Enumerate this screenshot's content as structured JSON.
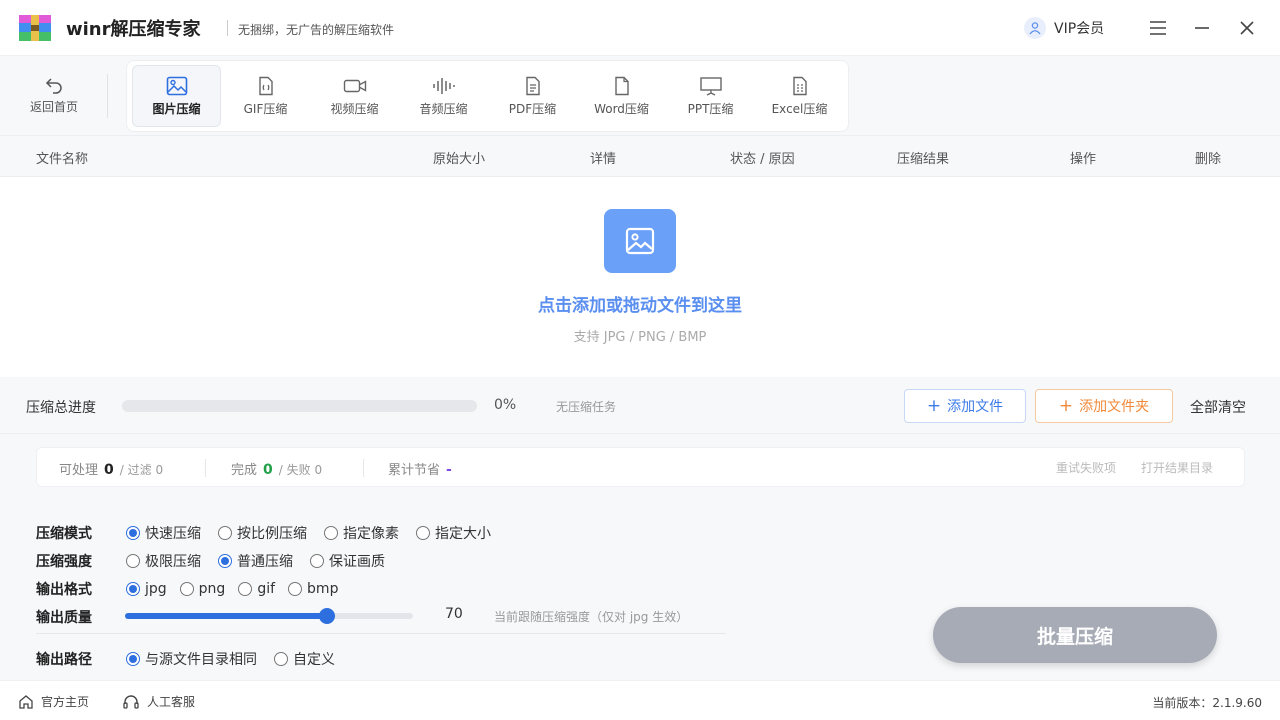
{
  "header": {
    "app_title": "winr解压缩专家",
    "subtitle": "无捆绑，无广告的解压缩软件",
    "vip_label": "VIP会员"
  },
  "toolbar": {
    "back_label": "返回首页",
    "tabs": [
      {
        "label": "图片压缩",
        "icon": "image-icon",
        "active": true
      },
      {
        "label": "GIF压缩",
        "icon": "gif-file-icon",
        "active": false
      },
      {
        "label": "视频压缩",
        "icon": "video-icon",
        "active": false
      },
      {
        "label": "音频压缩",
        "icon": "audio-wave-icon",
        "active": false
      },
      {
        "label": "PDF压缩",
        "icon": "pdf-file-icon",
        "active": false
      },
      {
        "label": "Word压缩",
        "icon": "word-file-icon",
        "active": false
      },
      {
        "label": "PPT压缩",
        "icon": "presentation-icon",
        "active": false
      },
      {
        "label": "Excel压缩",
        "icon": "excel-file-icon",
        "active": false
      }
    ]
  },
  "table": {
    "columns": [
      "文件名称",
      "原始大小",
      "详情",
      "状态 / 原因",
      "压缩结果",
      "操作",
      "删除"
    ]
  },
  "dropzone": {
    "title": "点击添加或拖动文件到这里",
    "subtitle": "支持 JPG / PNG / BMP"
  },
  "progress": {
    "label": "压缩总进度",
    "value": 0,
    "percent_text": "0%",
    "status": "无压缩任务",
    "add_file": "添加文件",
    "add_folder": "添加文件夹",
    "clear_all": "全部清空"
  },
  "stats": {
    "processable_label": "可处理",
    "processable": "0",
    "filtered": "/ 过滤 0",
    "done_label": "完成",
    "done": "0",
    "failed": "/ 失败 0",
    "saved_label": "累计节省",
    "saved": "-",
    "retry_label": "重试失败项",
    "open_dir_label": "打开结果目录"
  },
  "settings": {
    "mode_label": "压缩模式",
    "mode_options": [
      "快速压缩",
      "按比例压缩",
      "指定像素",
      "指定大小"
    ],
    "mode_selected": 0,
    "strength_label": "压缩强度",
    "strength_options": [
      "极限压缩",
      "普通压缩",
      "保证画质"
    ],
    "strength_selected": 1,
    "format_label": "输出格式",
    "format_options": [
      "jpg",
      "png",
      "gif",
      "bmp"
    ],
    "format_selected": 0,
    "quality_label": "输出质量",
    "quality_value": "70",
    "quality_fraction": 0.7,
    "quality_note": "当前跟随压缩强度（仅对 jpg 生效）",
    "path_label": "输出路径",
    "path_options": [
      "与源文件目录相同",
      "自定义"
    ],
    "path_selected": 0
  },
  "batch_button": "批量压缩",
  "footer": {
    "homepage": "官方主页",
    "support": "人工客服",
    "version": "当前版本：2.1.9.60"
  },
  "colors": {
    "accent": "#2e6fe0",
    "drop_text": "#5a8ff0",
    "folder_accent": "#f08a3a",
    "done_green": "#22a04a"
  }
}
